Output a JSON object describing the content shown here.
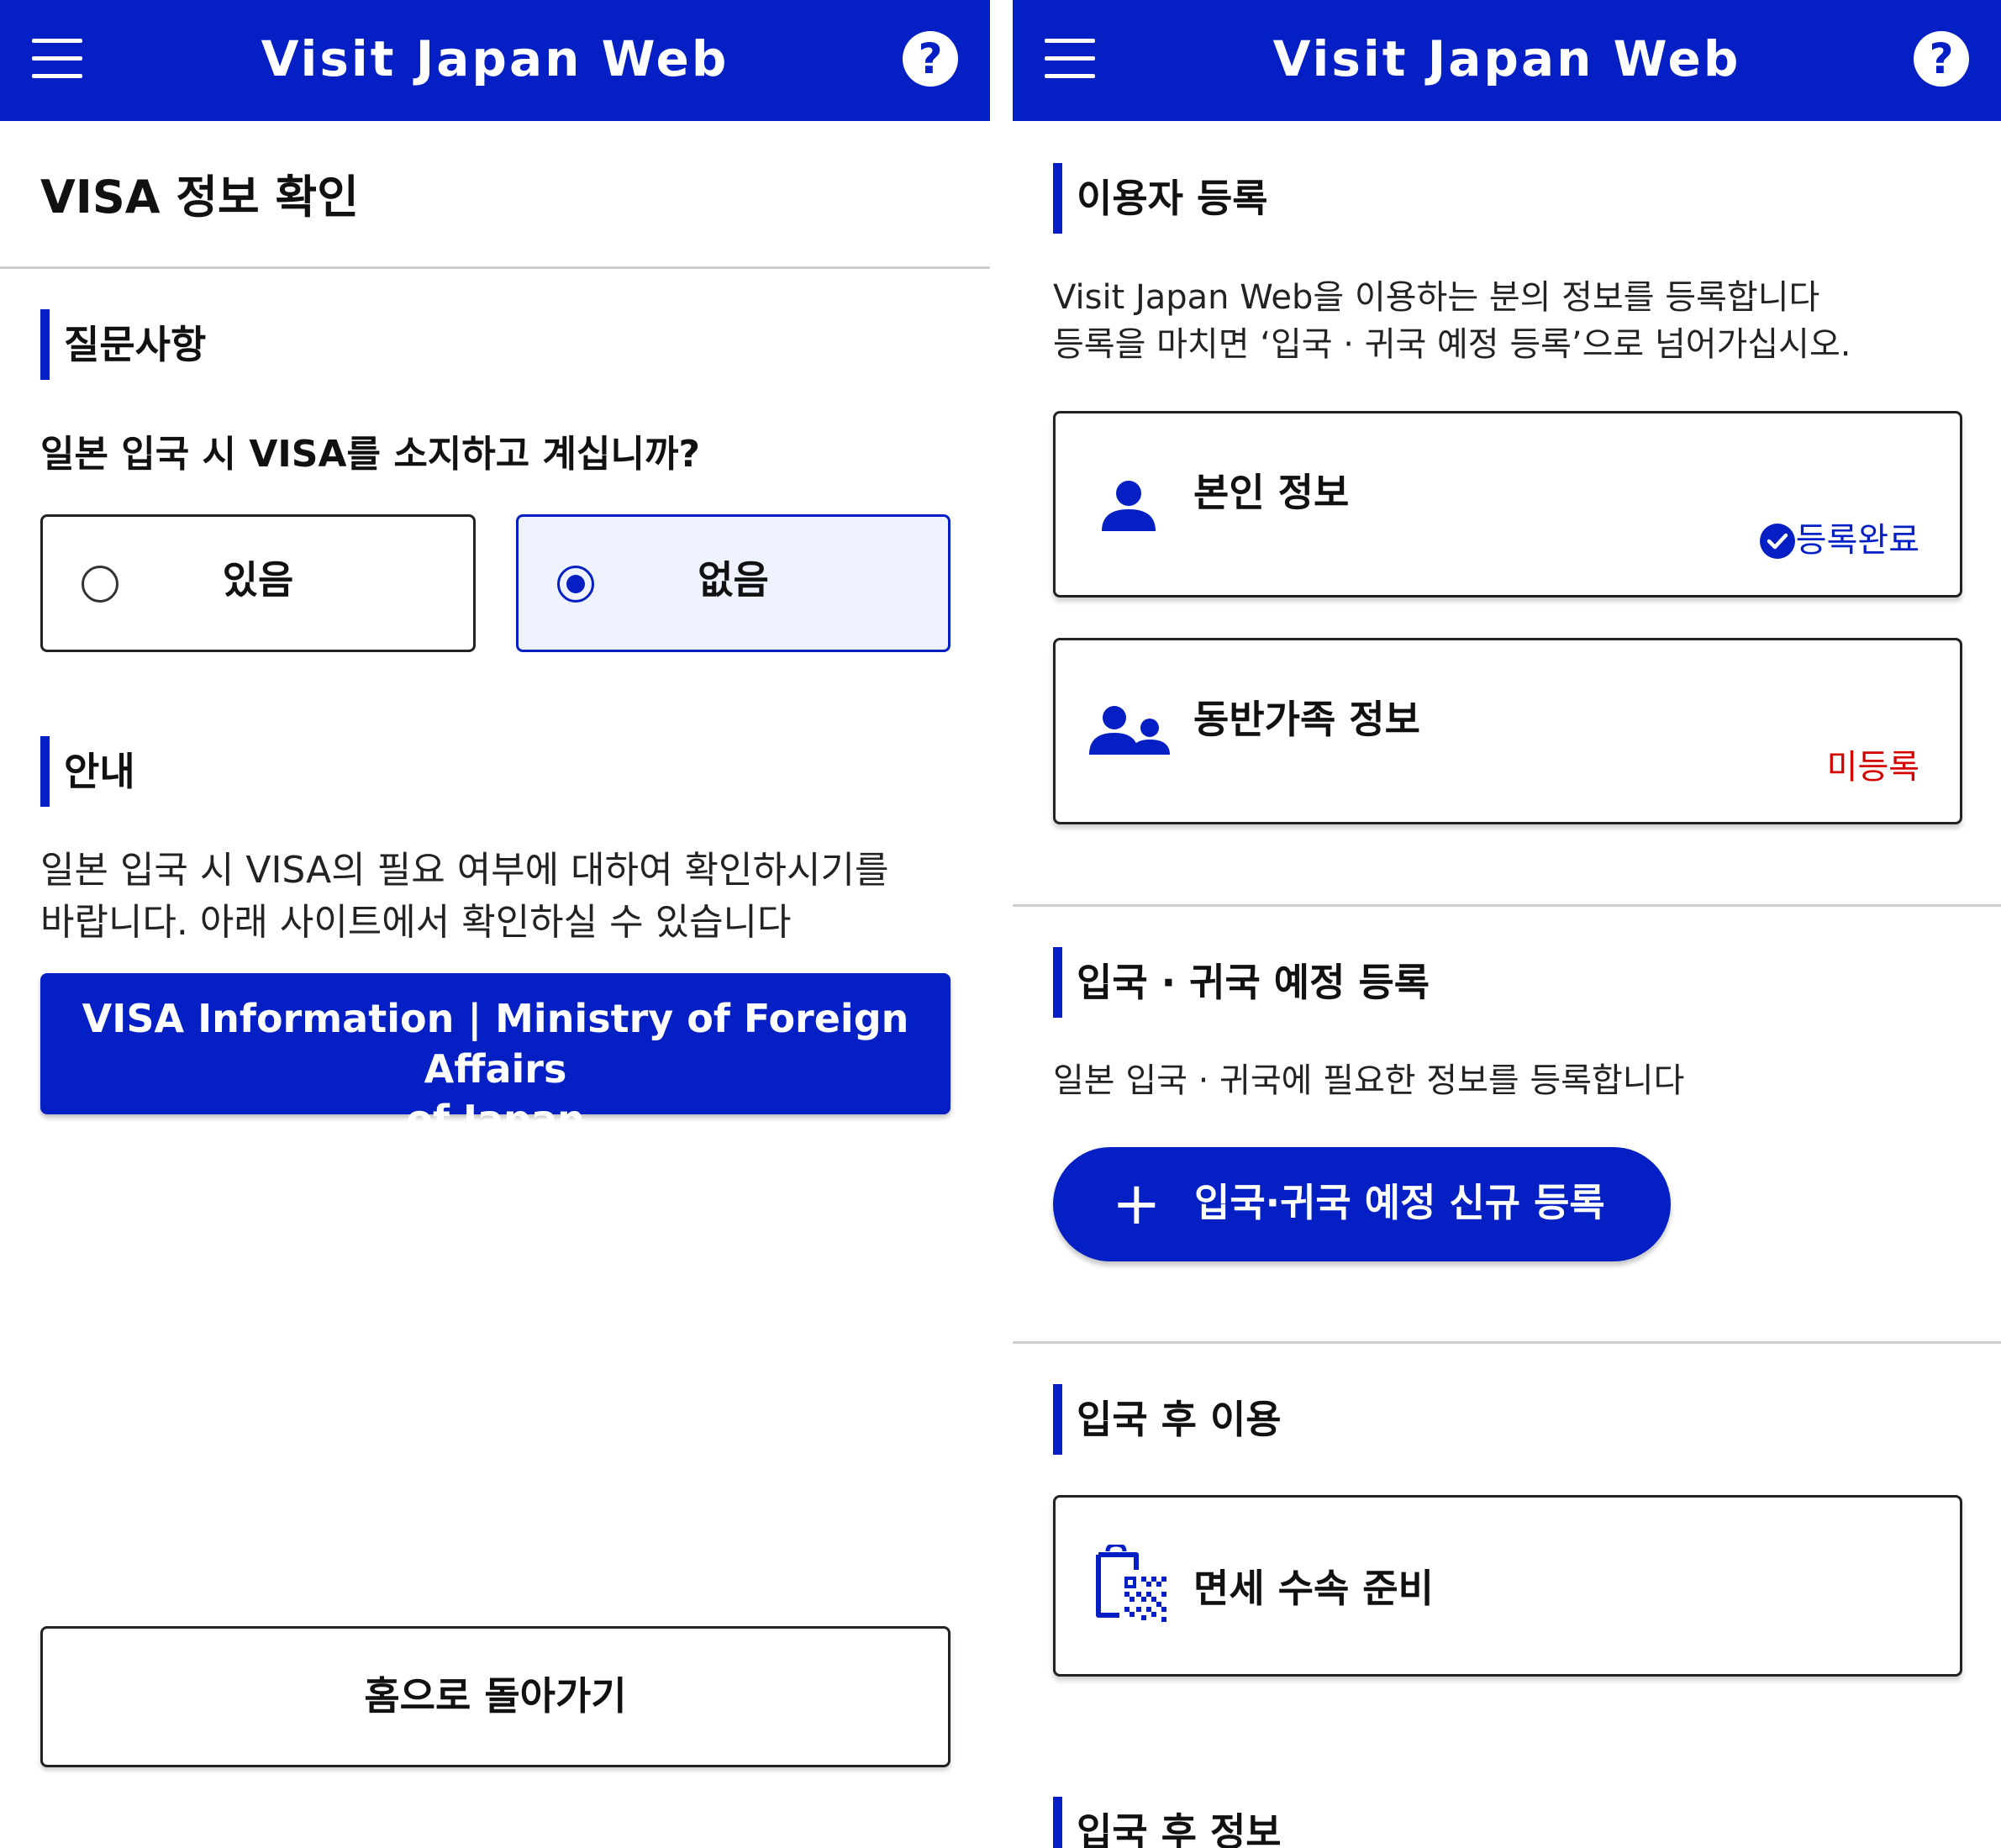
{
  "app": {
    "title": "Visit Japan Web"
  },
  "left": {
    "page_title": "VISA 정보 확인",
    "question_section": "질문사항",
    "question": "일본 입국 시 VISA를 소지하고 계십니까?",
    "options": [
      {
        "label": "있음",
        "selected": false
      },
      {
        "label": "없음",
        "selected": true
      }
    ],
    "guide_section": "안내",
    "guide_line1": "일본 입국 시 VISA의 필요 여부에 대하여 확인하시기를",
    "guide_line2": "바랍니다. 아래 사이트에서 확인하실 수 있습니다",
    "visa_link_line1": "VISA Information | Ministry of Foreign Affairs",
    "visa_link_line2": "of Japan",
    "home_button": "홈으로 돌아가기"
  },
  "right": {
    "user_section": "이용자 등록",
    "user_desc1": "Visit Japan Web을 이용하는 분의 정보를 등록합니다",
    "user_desc2": "등록을 마치면 ‘입국 · 귀국 예정 등록’으로 넘어가십시오.",
    "cards": [
      {
        "title": "본인 정보",
        "status": "등록완료",
        "icon": "person-icon",
        "status_color": "#0420c4"
      },
      {
        "title": "동반가족 정보",
        "status": "미등록",
        "icon": "family-icon",
        "status_color": "#d40000"
      }
    ],
    "entry_section": "입국 · 귀국 예정 등록",
    "entry_desc": "일본 입국 · 귀국에 필요한 정보를 등록합니다",
    "add_button": "입국·귀국 예정 신규 등록",
    "after_section": "입국 후 이용",
    "tax_free_card": "면세 수속 준비",
    "after_info_section": "입국 후 정보"
  },
  "colors": {
    "brand": "#0420c4",
    "status_ok": "#0420c4",
    "status_pending": "#d40000"
  }
}
